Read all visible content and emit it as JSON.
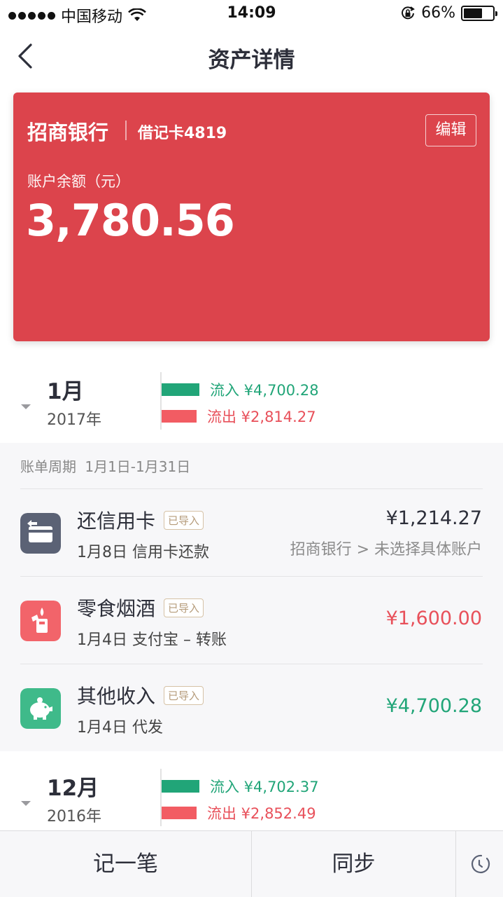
{
  "status_bar": {
    "carrier": "中国移动",
    "time": "14:09",
    "battery": "66%",
    "battery_level": 0.66
  },
  "nav": {
    "title": "资产详情",
    "back_icon": "chevron-left-icon"
  },
  "account": {
    "bank_name": "招商银行",
    "card_type": "借记卡4819",
    "edit_label": "编辑",
    "balance_label": "账户余额（元）",
    "balance": "3,780.56",
    "color": "#dc444c"
  },
  "months": [
    {
      "month": "1月",
      "year": "2017年",
      "inflow": "流入 ¥4,700.28",
      "outflow": "流出 ¥2,814.27"
    },
    {
      "month": "12月",
      "year": "2016年",
      "inflow": "流入 ¥4,702.37",
      "outflow": "流出 ¥2,852.49"
    }
  ],
  "bill": {
    "period": "账单周期 1月1日-1月31日",
    "transactions": [
      {
        "title": "还信用卡",
        "tag": "已导入",
        "subtitle": "1月8日  信用卡还款",
        "amount": "¥1,214.27",
        "account": "招商银行 > 未选择具体账户",
        "icon": "credit-card-icon",
        "icon_color": "#5b6275",
        "amount_color": "#2d2f3a"
      },
      {
        "title": "零食烟酒",
        "tag": "已导入",
        "subtitle": "1月4日  支付宝 – 转账",
        "amount": "¥1,600.00",
        "icon": "lighter-icon",
        "icon_color": "#f2646a",
        "amount_color": "#e8505a"
      },
      {
        "title": "其他收入",
        "tag": "已导入",
        "subtitle": "1月4日  代发",
        "amount": "¥4,700.28",
        "icon": "piggy-bank-icon",
        "icon_color": "#3fba8a",
        "amount_color": "#21a578"
      }
    ]
  },
  "bottom_bar": {
    "record_label": "记一笔",
    "sync_label": "同步",
    "history_icon": "clock-icon"
  },
  "colors": {
    "inflow": "#21a578",
    "outflow": "#f25c63"
  }
}
